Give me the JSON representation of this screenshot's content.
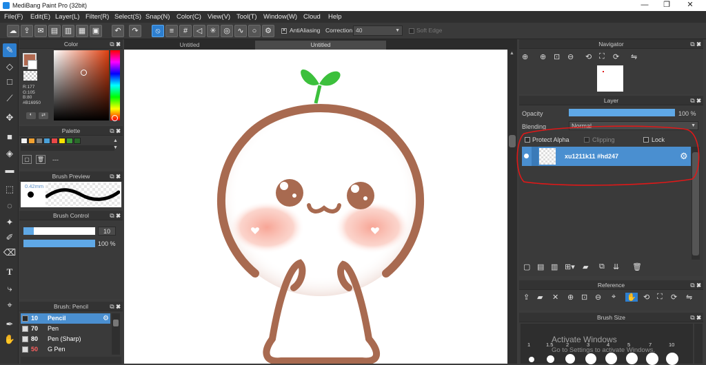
{
  "app": {
    "title": "MediBang Paint Pro (32bit)",
    "window_buttons": [
      "—",
      "❐",
      "✕"
    ]
  },
  "menu": [
    "File(F)",
    "Edit(E)",
    "Layer(L)",
    "Filter(R)",
    "Select(S)",
    "Snap(N)",
    "Color(C)",
    "View(V)",
    "Tool(T)",
    "Window(W)",
    "Cloud",
    "Help"
  ],
  "toolbar": {
    "antialiasing_label": "AntiAliasing",
    "correction_label": "Correction",
    "correction_value": "40",
    "soft_edge_label": "Soft Edge"
  },
  "color_panel": {
    "title": "Color",
    "fg_color": "#b16950",
    "readout": [
      "R:177",
      "G:105",
      "B:80",
      "#B16950"
    ]
  },
  "palette_panel": {
    "title": "Palette",
    "swatches": [
      "#f2f2f2",
      "#f0a030",
      "#7b7b7b",
      "#4aa0d8",
      "#e84848",
      "#f5e000",
      "#3a9a3a",
      "#2a6a2a"
    ],
    "dashes": "---"
  },
  "brush_preview": {
    "title": "Brush Preview",
    "size_label": "0.42mm"
  },
  "brush_control": {
    "title": "Brush Control",
    "size_value": "10",
    "opacity_value": "100 %",
    "size_fraction": 0.14,
    "opacity_fraction": 1.0
  },
  "brush_list": {
    "title": "Brush: Pencil",
    "items": [
      {
        "size": "10",
        "name": "Pencil",
        "selected": true
      },
      {
        "size": "70",
        "name": "Pen",
        "selected": false
      },
      {
        "size": "80",
        "name": "Pen (Sharp)",
        "selected": false
      },
      {
        "size": "50",
        "name": "G Pen",
        "selected": false
      }
    ]
  },
  "canvas": {
    "tabs": [
      "Untitled",
      "Untitled"
    ]
  },
  "navigator": {
    "title": "Navigator"
  },
  "layer_panel": {
    "title": "Layer",
    "opacity_label": "Opacity",
    "opacity_value": "100 %",
    "opacity_fraction": 1.0,
    "blending_label": "Blending",
    "blending_value": "Normal",
    "protect_alpha": "Protect Alpha",
    "clipping": "Clipping",
    "lock": "Lock",
    "layer_name": "xu1211k11 #hd247"
  },
  "reference_panel": {
    "title": "Reference"
  },
  "brush_size_panel": {
    "title": "Brush Size",
    "labels": [
      "1",
      "1.5",
      "2",
      "3",
      "4",
      "5",
      "7",
      "10"
    ]
  },
  "watermark": {
    "line1": "Activate Windows",
    "line2": "Go to Settings to activate Windows."
  },
  "colors": {
    "accent": "#2d7fd0",
    "annotation_red": "#e01818",
    "outline_brown": "#a86a50",
    "blush": "#f7a090",
    "leaf_green": "#3cc03c"
  }
}
